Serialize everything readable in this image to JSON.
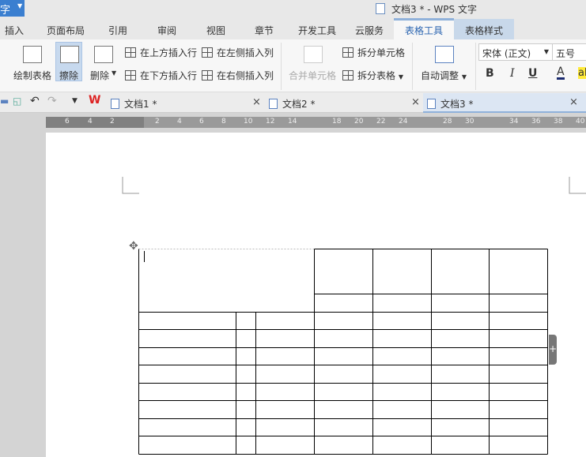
{
  "app": {
    "menu_label": "字",
    "title": "文档3 * - WPS 文字"
  },
  "menu_tabs": [
    "插入",
    "页面布局",
    "引用",
    "审阅",
    "视图",
    "章节",
    "开发工具",
    "云服务",
    "表格工具",
    "表格样式"
  ],
  "ribbon": {
    "draw_table": "绘制表格",
    "erase": "擦除",
    "delete": "删除",
    "insert_above": "在上方插入行",
    "insert_below": "在下方插入行",
    "insert_left": "在左侧插入列",
    "insert_right": "在右侧插入列",
    "merge_cells": "合并单元格",
    "split_cells": "拆分单元格",
    "split_table": "拆分表格",
    "autofit": "自动调整",
    "font": "宋体 (正文)",
    "size": "五号",
    "bold": "B",
    "italic": "I",
    "underline": "U",
    "font_color": "A",
    "highlight": "ab"
  },
  "doc_tabs": [
    {
      "label": "文档1 *"
    },
    {
      "label": "文档2 *"
    },
    {
      "label": "文档3 *",
      "active": true
    }
  ],
  "ruler": [
    "6",
    "4",
    "2",
    "2",
    "4",
    "6",
    "8",
    "10",
    "12",
    "14",
    "18",
    "20",
    "22",
    "24",
    "28",
    "30",
    "34",
    "36",
    "38",
    "40"
  ],
  "colors": {
    "accent": "#3b7fd0",
    "active_tab": "#8fb1da",
    "style_tab": "#c8d8ea"
  }
}
